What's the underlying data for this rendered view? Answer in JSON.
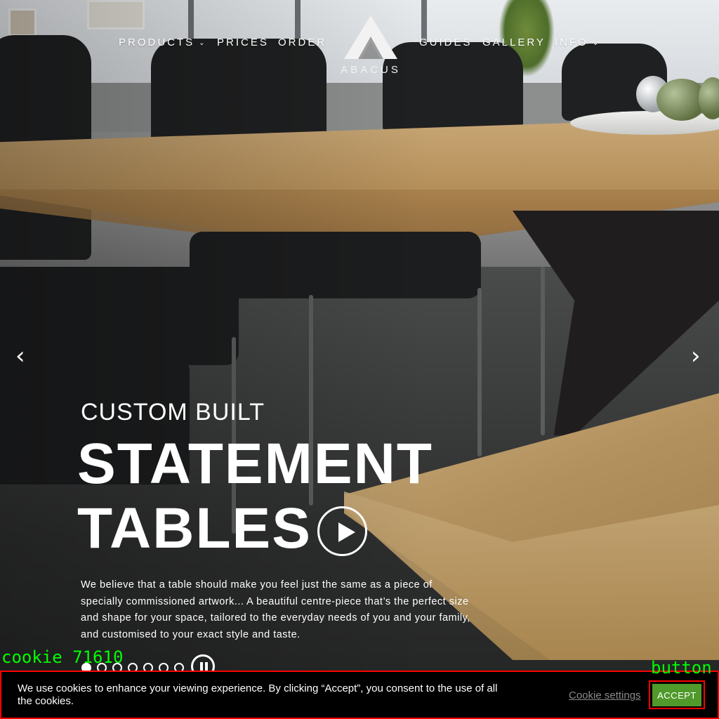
{
  "nav": {
    "items": [
      {
        "label": "PRODUCTS",
        "has_caret": true
      },
      {
        "label": "PRICES",
        "has_caret": false
      },
      {
        "label": "ORDER",
        "has_caret": false
      },
      {
        "label": "GUIDES",
        "has_caret": false
      },
      {
        "label": "GALLERY",
        "has_caret": false
      },
      {
        "label": "INFO",
        "has_caret": true
      }
    ],
    "caret_glyph": "⌄"
  },
  "logo": {
    "text": "ABACUS",
    "icon": "abacus-logo-icon"
  },
  "slider": {
    "prev_glyph": "‹",
    "next_glyph": "›",
    "slide_count": 7,
    "active_index": 0
  },
  "hero": {
    "subtitle": "CUSTOM BUILT",
    "title_line1": "STATEMENT",
    "title_line2": "TABLES",
    "body": "We believe that a table should make you feel just the same as a piece of specially commissioned artwork... A beautiful centre-piece that’s the perfect size and shape for your space, tailored to the everyday needs of you and your family, and customised to your exact style and taste."
  },
  "cookie": {
    "message": "We use cookies to enhance your viewing experience. By clicking “Accept”, you consent to the use of all the cookies.",
    "settings_label": "Cookie settings",
    "accept_label": "ACCEPT"
  },
  "annotations": {
    "cookie_label": "cookie 71610",
    "button_label": "button",
    "color": "#00ff00",
    "box_color": "#ff0000"
  },
  "colors": {
    "accept_button": "#4f9a2a",
    "cookie_bar": "#000000",
    "text": "#ffffff"
  }
}
